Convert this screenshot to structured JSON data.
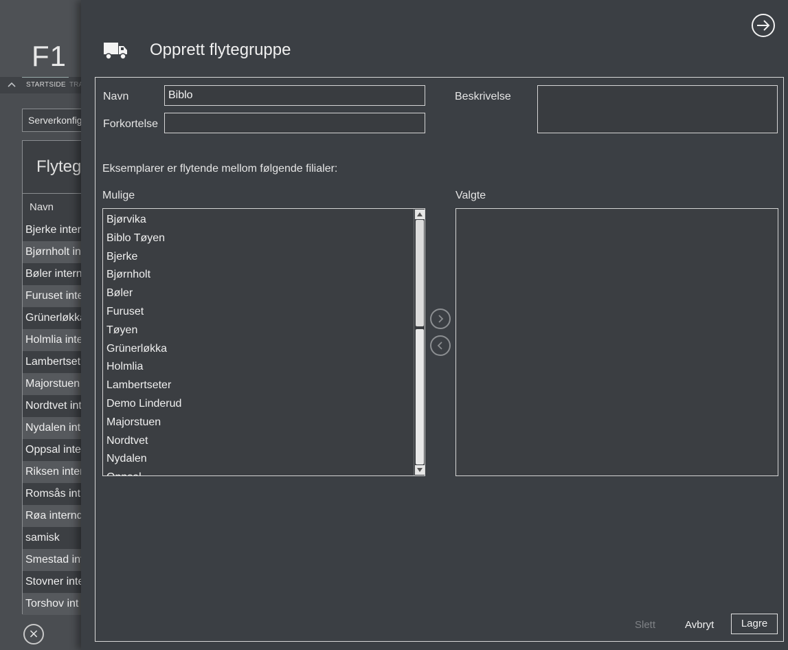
{
  "background_app": {
    "logo": "F1",
    "tabs": {
      "start": "STARTSIDE",
      "next": "TRA"
    },
    "server_select_value": "Serverkonfig",
    "list_title": "Flyteg",
    "list_column": "Navn",
    "rows": [
      "Bjerke inter",
      "Bjørnholt in",
      "Bøler intern",
      "Furuset inte",
      "Grünerløkka",
      "Holmlia inte",
      "Lambertset",
      "Majorstuen",
      "Nordtvet int",
      "Nydalen int",
      "Oppsal inte",
      "Riksen inter",
      "Romsås int",
      "Røa internd",
      "samisk",
      "Smestad int",
      "Stovner inte",
      "Torshov int"
    ],
    "close_icon": "×"
  },
  "dialog": {
    "title": "Opprett flytegruppe",
    "icon": "truck-icon",
    "exit_icon": "arrow-right-circle-icon",
    "fields": {
      "navn_label": "Navn",
      "navn_value": "Biblo",
      "forkortelse_label": "Forkortelse",
      "forkortelse_value": "",
      "beskrivelse_label": "Beskrivelse",
      "beskrivelse_value": ""
    },
    "instructions": "Eksemplarer er flytende mellom følgende filialer:",
    "mulige_label": "Mulige",
    "valgte_label": "Valgte",
    "mulige_items": [
      "Bjørvika",
      "Biblo Tøyen",
      "Bjerke",
      "Bjørnholt",
      "Bøler",
      "Furuset",
      "Tøyen",
      "Grünerløkka",
      "Holmlia",
      "Lambertseter",
      "Demo Linderud",
      "Majorstuen",
      "Nordtvet",
      "Nydalen",
      "Oppsal"
    ],
    "valgte_items": [],
    "buttons": {
      "slett": "Slett",
      "avbryt": "Avbryt",
      "lagre": "Lagre"
    }
  },
  "colors": {
    "panel_bg": "#3b3f44",
    "border": "#d9d9d9",
    "disabled_text": "#7f8286"
  }
}
